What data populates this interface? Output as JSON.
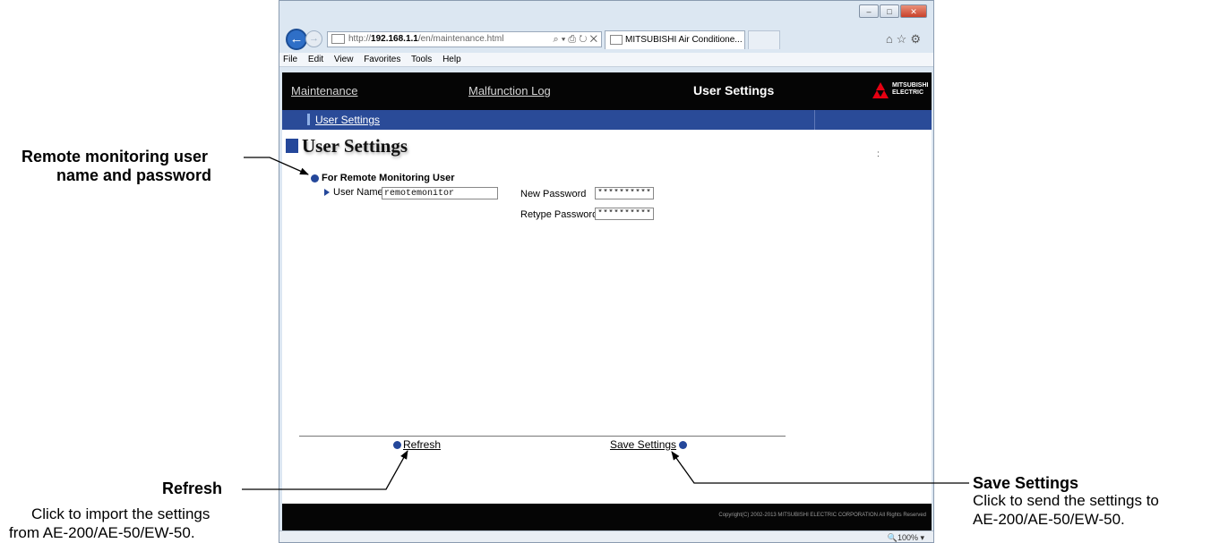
{
  "callouts": {
    "remote": {
      "title_line1": "Remote monitoring user",
      "title_line2": "name and password"
    },
    "refresh": {
      "title": "Refresh",
      "desc_line1": "Click to import the settings",
      "desc_line2": "from AE-200/AE-50/EW-50."
    },
    "save": {
      "title": "Save Settings",
      "desc_line1": "Click to send the settings to",
      "desc_line2": "AE-200/AE-50/EW-50."
    }
  },
  "browser": {
    "address_prefix": "http://",
    "address_host": "192.168.1.1",
    "address_path": "/en/maintenance.html",
    "address_tools": "⌕ ▾ ⎙ ↻ ✕",
    "tab_title": "MITSUBISHI Air Conditione...",
    "tab_close": "×",
    "toolbar_icons": "⌂☆⚙",
    "window_controls": [
      "–",
      "□",
      "✕"
    ],
    "menu": [
      "File",
      "Edit",
      "View",
      "Favorites",
      "Tools",
      "Help"
    ],
    "zoom": "🔍100%  ▾"
  },
  "nav": {
    "maintenance": "Maintenance",
    "malfunction_log": "Malfunction Log",
    "user_settings": "User Settings",
    "sub_user_settings": "User Settings"
  },
  "logo": {
    "line1": "MITSUBISHI",
    "line2": "ELECTRIC"
  },
  "page": {
    "title": "User Settings",
    "stray_text": ":",
    "section_title": "For Remote Monitoring User",
    "user_name_label": "User Name",
    "user_name_value": "remotemonitor",
    "new_password_label": "New Password",
    "new_password_value": "**********",
    "retype_password_label": "Retype Password",
    "retype_password_value": "**********",
    "refresh": "Refresh",
    "save_settings": "Save Settings",
    "copyright": "Copyright(C) 2002-2013 MITSUBISHI ELECTRIC CORPORATION All Rights Reserved"
  }
}
